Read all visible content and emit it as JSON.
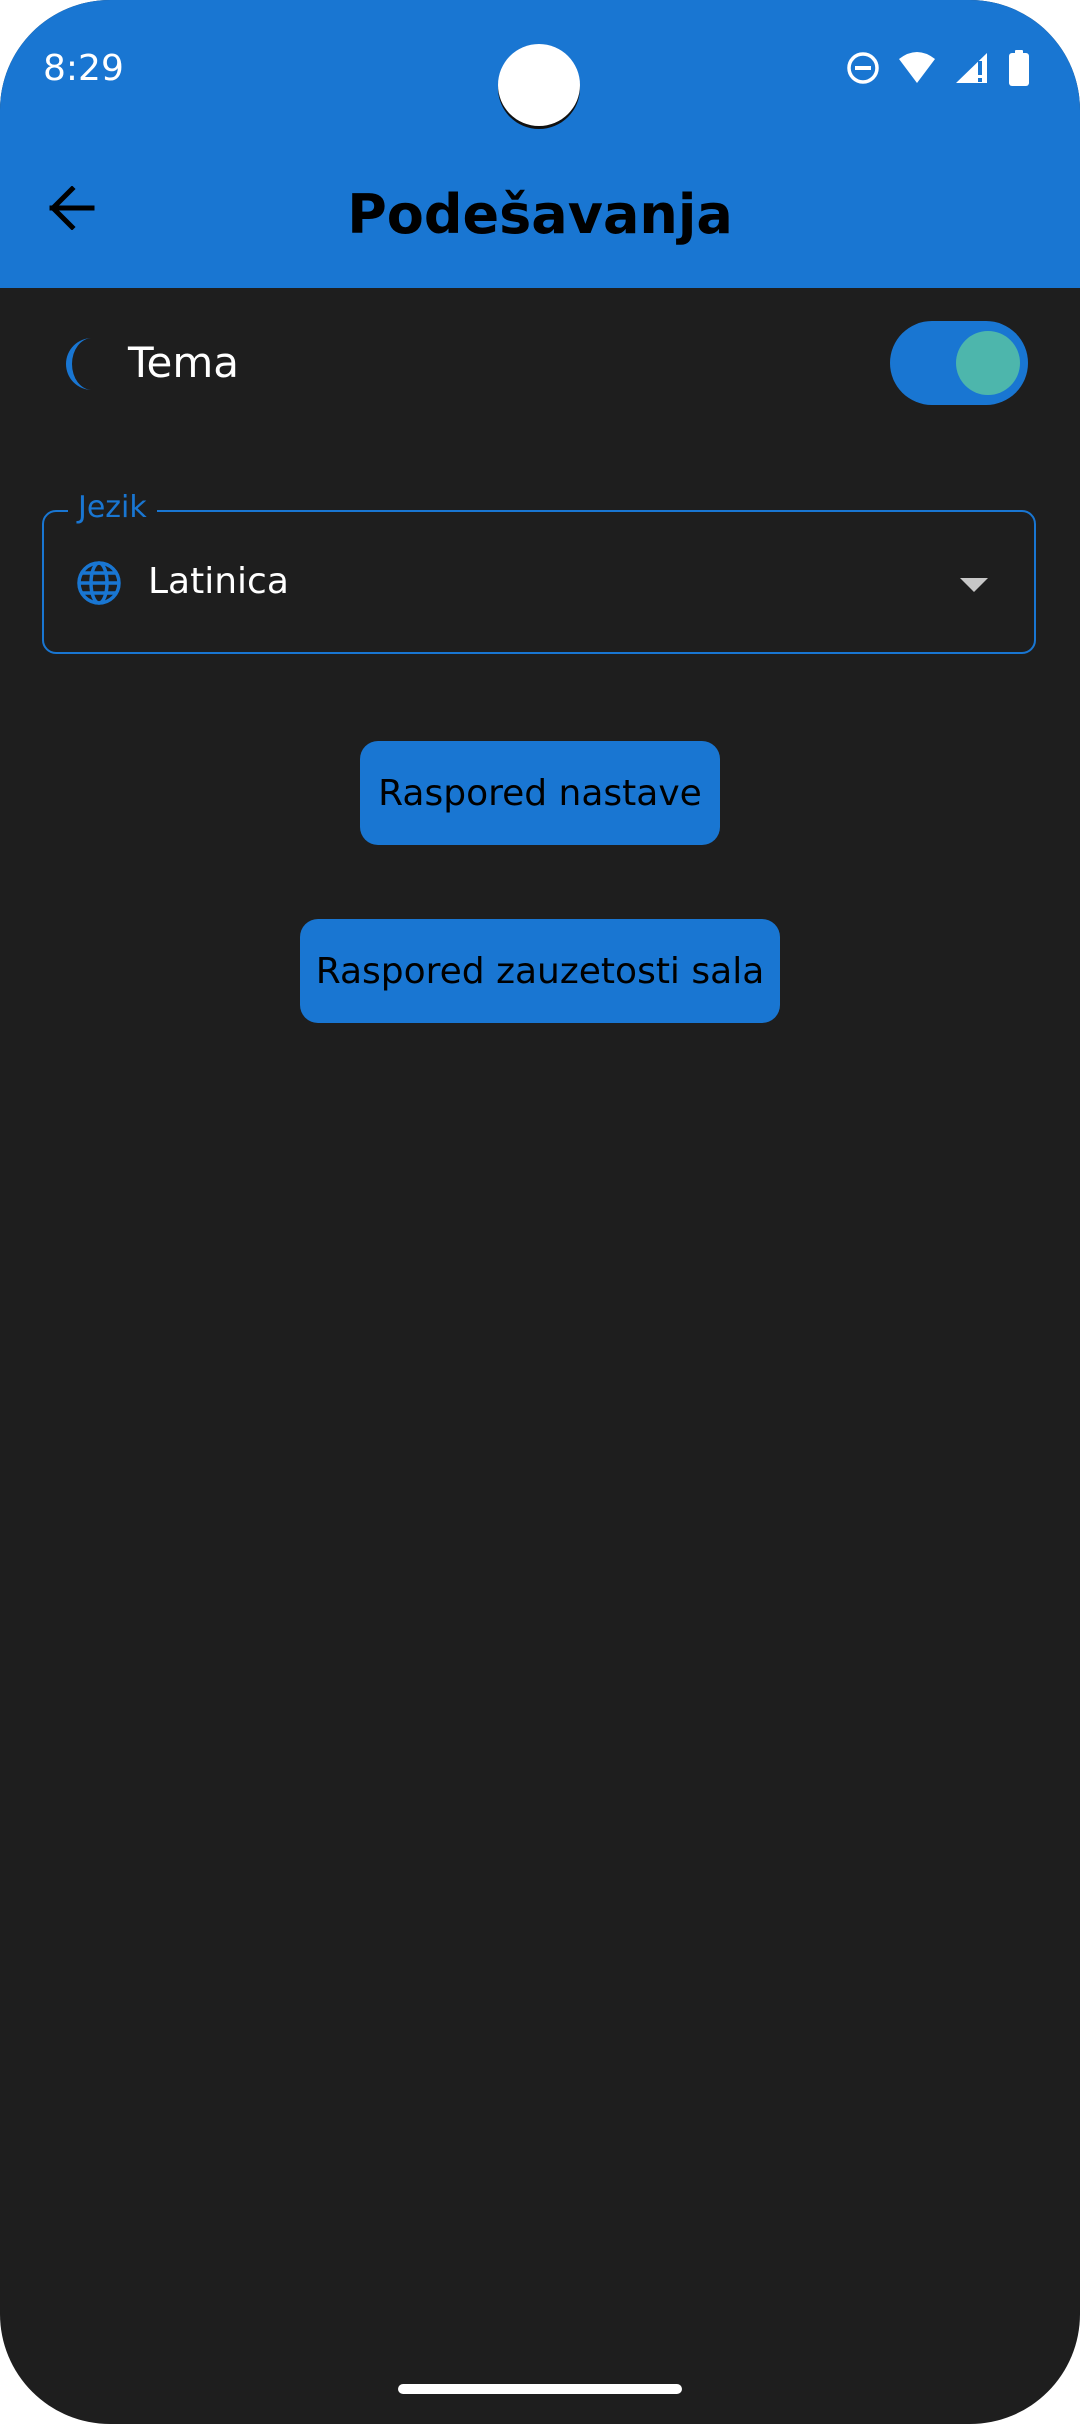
{
  "status_bar": {
    "time": "8:29",
    "icons": [
      "do-not-disturb-icon",
      "wifi-icon",
      "cell-signal-icon",
      "battery-icon"
    ]
  },
  "app_bar": {
    "title": "Podešavanja",
    "back_icon": "arrow-back-icon",
    "color": "#1976d2"
  },
  "settings": {
    "theme": {
      "icon": "moon-icon",
      "label": "Tema",
      "toggle_on": true
    },
    "language": {
      "legend": "Jezik",
      "icon": "globe-icon",
      "value": "Latinica"
    }
  },
  "buttons": {
    "schedule": "Raspored nastave",
    "rooms": "Raspored zauzetosti sala"
  },
  "colors": {
    "accent": "#1976d2",
    "background": "#1e1e1e",
    "toggle_knob": "#4db6ac"
  }
}
